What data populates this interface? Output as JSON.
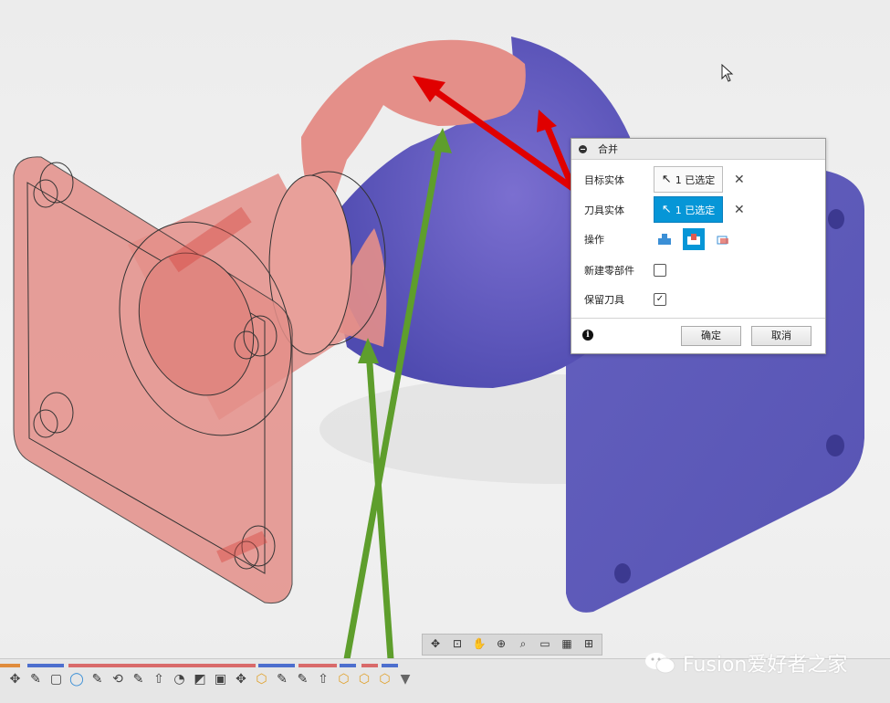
{
  "dialog": {
    "title": "合并",
    "rows": {
      "target": {
        "label": "目标实体",
        "value": "1 已选定"
      },
      "tool": {
        "label": "刀具实体",
        "value": "1 已选定"
      },
      "operation": {
        "label": "操作"
      },
      "new_component": {
        "label": "新建零部件",
        "checked": false
      },
      "keep_tools": {
        "label": "保留刀具",
        "checked": true
      }
    },
    "ok_label": "确定",
    "cancel_label": "取消"
  },
  "watermark": {
    "text": "Fusion爱好者之家"
  },
  "colors": {
    "tool_body": "#e48f89",
    "target_body": "#5e5ab9",
    "accent_blue": "#0696d7",
    "red_arrow": "#e00000",
    "green_arrow": "#5e9e2c"
  },
  "icons": {
    "navbar": [
      "orbit-icon",
      "look-at-icon",
      "pan-icon",
      "zoom-icon",
      "fit-icon",
      "display-settings-icon",
      "grid-icon",
      "viewports-icon"
    ],
    "timeline": [
      "move-icon",
      "sketch-icon",
      "box-icon",
      "sphere-icon",
      "sketch-icon",
      "revolve-icon",
      "sketch-icon",
      "extrude-icon",
      "fillet-icon",
      "chamfer-icon",
      "shell-icon",
      "move-icon",
      "combine-icon",
      "sketch-icon",
      "sketch-icon",
      "extrude-icon",
      "combine-icon",
      "combine-icon",
      "combine-icon",
      "marker-icon"
    ]
  }
}
